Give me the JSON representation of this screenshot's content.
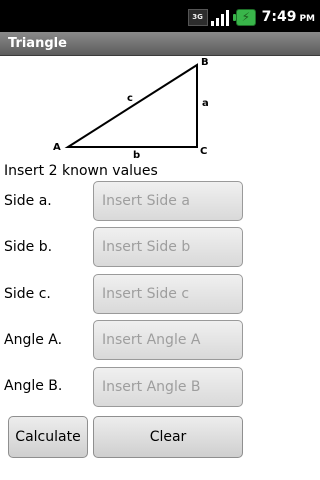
{
  "status_bar": {
    "network": "3G",
    "time": "7:49",
    "ampm": "PM",
    "icons": [
      "network-3g-icon",
      "signal-icon",
      "battery-charging-icon"
    ]
  },
  "app": {
    "title": "Triangle"
  },
  "diagram": {
    "vertices": {
      "a": "A",
      "b": "B",
      "c": "C"
    },
    "sides": {
      "a": "a",
      "b": "b",
      "c": "c"
    }
  },
  "instruction": "Insert 2 known values",
  "fields": [
    {
      "label": "Side a.",
      "placeholder": "Insert Side a",
      "value": ""
    },
    {
      "label": "Side b.",
      "placeholder": "Insert Side b",
      "value": ""
    },
    {
      "label": "Side c.",
      "placeholder": "Insert Side c",
      "value": ""
    },
    {
      "label": "Angle A.",
      "placeholder": "Insert Angle A",
      "value": ""
    },
    {
      "label": "Angle B.",
      "placeholder": "Insert Angle B",
      "value": ""
    }
  ],
  "buttons": {
    "calculate": "Calculate",
    "clear": "Clear"
  },
  "colors": {
    "status_bar_bg": "#000000",
    "title_bar_bg": "#707070",
    "battery": "#39b54a",
    "placeholder_text": "#9e9e9e"
  }
}
